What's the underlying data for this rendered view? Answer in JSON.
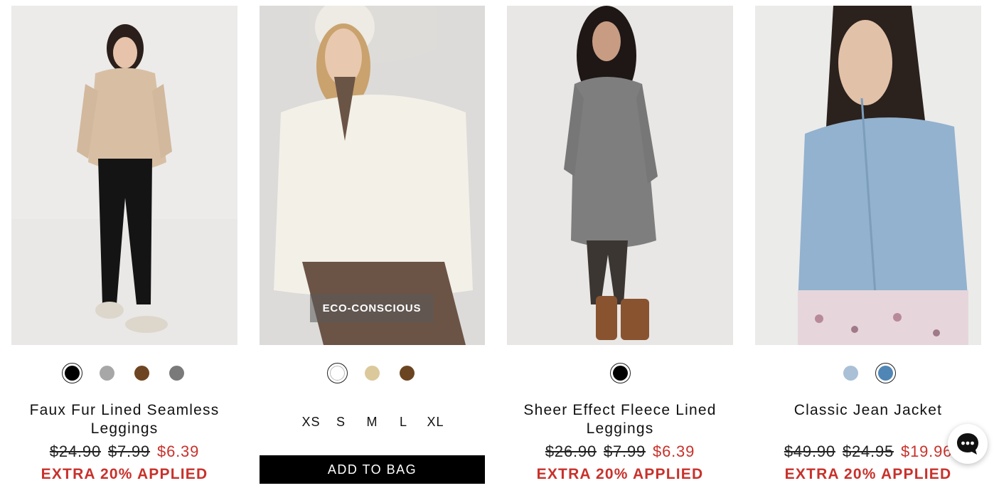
{
  "products": [
    {
      "name": "Faux Fur Lined Seamless Leggings",
      "price_original": "$24.90",
      "price_was": "$7.99",
      "price_sale": "$6.39",
      "promo": "EXTRA 20% APPLIED",
      "swatches": [
        "#000000",
        "#a7a7a7",
        "#6e4522",
        "#7a7a7a"
      ],
      "selected_swatch": 0
    },
    {
      "badge": "ECO-CONSCIOUS",
      "swatches": [
        "#ffffff",
        "#dcc99b",
        "#6b4522"
      ],
      "selected_swatch": 0,
      "sizes": [
        "XS",
        "S",
        "M",
        "L",
        "XL"
      ],
      "add_to_bag": "ADD TO BAG"
    },
    {
      "name": "Sheer Effect Fleece Lined Leggings",
      "price_original": "$26.90",
      "price_was": "$7.99",
      "price_sale": "$6.39",
      "promo": "EXTRA 20% APPLIED",
      "swatches": [
        "#000000"
      ],
      "selected_swatch": 0
    },
    {
      "name": "Classic Jean Jacket",
      "price_original": "$49.90",
      "price_was": "$24.95",
      "price_sale": "$19.96",
      "promo": "EXTRA 20% APPLIED",
      "swatches": [
        "#a9c0d6",
        "#4f86b5"
      ],
      "selected_swatch": 1
    }
  ],
  "chat_icon": "chat-bubble-icon"
}
